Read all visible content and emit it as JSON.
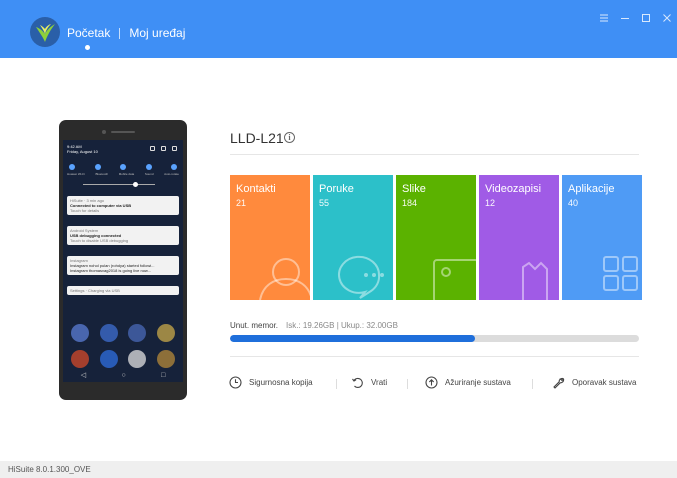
{
  "header": {
    "tabs": [
      {
        "label": "Početak",
        "active": true
      },
      {
        "label": "Moj uređaj",
        "active": false
      }
    ],
    "window_controls": [
      "menu-icon",
      "minimize-icon",
      "maximize-icon",
      "close-icon"
    ],
    "background_color": "#3f8ff5"
  },
  "device": {
    "name": "LLD-L21",
    "phone_screen": {
      "time": "9:42 AM",
      "date": "Friday, August 10",
      "toggle_labels": [
        "Huawei Wi-Fi",
        "Bluetooth",
        "Mobile data",
        "Sound",
        "Auto-rotate"
      ],
      "notifications": [
        {
          "app": "HiSuite · 3 min ago",
          "title": "Connected to computer via USB",
          "text": "Touch for details"
        },
        {
          "app": "Android System",
          "title": "USB debugging connected",
          "text": "Touch to disable USB debugging"
        },
        {
          "app": "Instagram",
          "title": "Instagram nohol pulan (rohdya) started followi...",
          "text": "Instagram thomasvag2018 is going live now..."
        },
        {
          "app": "Settings · Charging via USB",
          "title": "",
          "text": ""
        }
      ]
    }
  },
  "tiles": [
    {
      "label": "Kontakti",
      "count": "21",
      "color": "#ff8a3d",
      "icon": "contacts-icon"
    },
    {
      "label": "Poruke",
      "count": "55",
      "color": "#2cc0c9",
      "icon": "messages-icon"
    },
    {
      "label": "Slike",
      "count": "184",
      "color": "#5bb200",
      "icon": "images-icon"
    },
    {
      "label": "Videozapisi",
      "count": "12",
      "color": "#a05be6",
      "icon": "videos-icon"
    },
    {
      "label": "Aplikacije",
      "count": "40",
      "color": "#4f9bf5",
      "icon": "apps-icon"
    }
  ],
  "memory": {
    "label": "Unut. memor.",
    "value": "Isk.: 19.26GB | Ukup.: 32.00GB",
    "used_fraction": 0.6
  },
  "actions": [
    {
      "label": "Sigurnosna kopija",
      "icon": "backup-icon"
    },
    {
      "label": "Vrati",
      "icon": "restore-icon"
    },
    {
      "label": "Ažuriranje sustava",
      "icon": "system-update-icon"
    },
    {
      "label": "Oporavak sustava",
      "icon": "system-recovery-icon"
    }
  ],
  "footer": {
    "version": "HiSuite 8.0.1.300_OVE"
  }
}
